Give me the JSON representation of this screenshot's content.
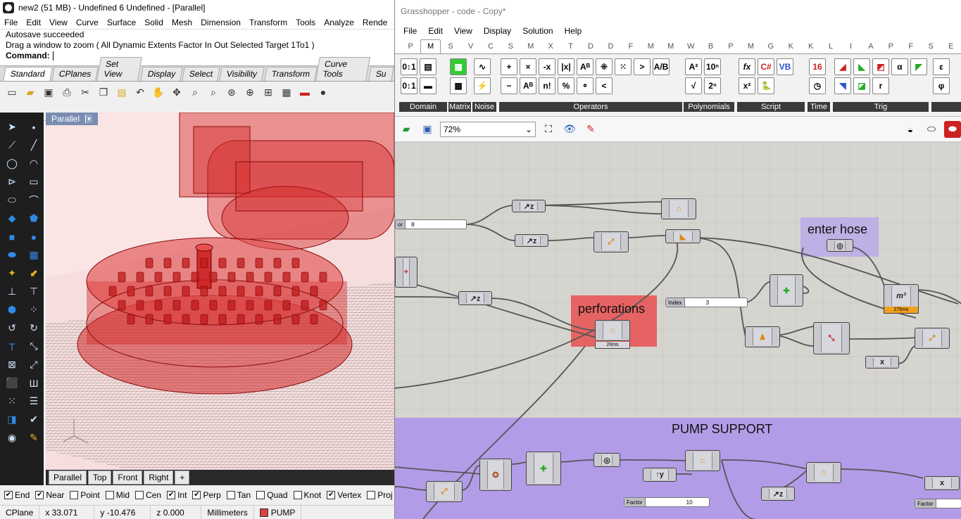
{
  "rhino": {
    "title": "new2 (51 MB) - Undefined 6 Undefined - [Parallel]",
    "menu": [
      "File",
      "Edit",
      "View",
      "Curve",
      "Surface",
      "Solid",
      "Mesh",
      "Dimension",
      "Transform",
      "Tools",
      "Analyze",
      "Rende"
    ],
    "command_history": [
      "Autosave succeeded",
      "Drag a window to zoom ( All  Dynamic  Extents  Factor  In  Out  Selected  Target  1To1 )"
    ],
    "command_label": "Command:",
    "toolbar_tabs": [
      "Standard",
      "CPlanes",
      "Set View",
      "Display",
      "Select",
      "Visibility",
      "Transform",
      "Curve Tools",
      "Su"
    ],
    "viewport_label": "Parallel",
    "viewport_tabs": [
      "Parallel",
      "Top",
      "Front",
      "Right",
      "+"
    ],
    "snaps": [
      {
        "label": "End",
        "checked": true
      },
      {
        "label": "Near",
        "checked": true
      },
      {
        "label": "Point",
        "checked": false
      },
      {
        "label": "Mid",
        "checked": false
      },
      {
        "label": "Cen",
        "checked": false
      },
      {
        "label": "Int",
        "checked": true
      },
      {
        "label": "Perp",
        "checked": true
      },
      {
        "label": "Tan",
        "checked": false
      },
      {
        "label": "Quad",
        "checked": false
      },
      {
        "label": "Knot",
        "checked": false
      },
      {
        "label": "Vertex",
        "checked": true
      },
      {
        "label": "Proj",
        "checked": false
      }
    ],
    "status": {
      "cplane": "CPlane",
      "x": "x 33.071",
      "y": "y -10.476",
      "z": "z 0.000",
      "units": "Millimeters",
      "layer": "PUMP"
    },
    "colors": {
      "viewport_bg": "#fbe4e4",
      "object": "#d92020",
      "left_bar": "#1e1e1e"
    }
  },
  "gh": {
    "title": "Grasshopper - code - Copy*",
    "menu": [
      "File",
      "Edit",
      "View",
      "Display",
      "Solution",
      "Help"
    ],
    "tabs": [
      "P",
      "M",
      "S",
      "V",
      "C",
      "S",
      "M",
      "X",
      "T",
      "D",
      "D",
      "F",
      "M",
      "M",
      "W",
      "B",
      "P",
      "M",
      "G",
      "K",
      "K",
      "L",
      "I",
      "A",
      "P",
      "F",
      "S",
      "E"
    ],
    "active_tab_index": 1,
    "ribbon_groups": [
      "Domain",
      "Matrix",
      "Noise",
      "Operators",
      "Polynomials",
      "Script",
      "Time",
      "Trig"
    ],
    "zoom": "72%",
    "groups": [
      {
        "label": "enter hose"
      },
      {
        "label": "perforations"
      },
      {
        "label": "PUMP SUPPORT"
      }
    ],
    "sliders": [
      {
        "label": "or",
        "value": "8"
      },
      {
        "label": "Index",
        "value": "3"
      },
      {
        "label": "Factor",
        "value": "10"
      },
      {
        "label": "Factor",
        "value": ""
      }
    ],
    "timers": [
      "276ms",
      "26ms"
    ],
    "colors": {
      "canvas": "#d6d4cf",
      "hose_group": "#b6a6e8",
      "perforations_group": "#e85050",
      "pump_group": "#b29ce8",
      "timer": "#f0a020"
    }
  }
}
